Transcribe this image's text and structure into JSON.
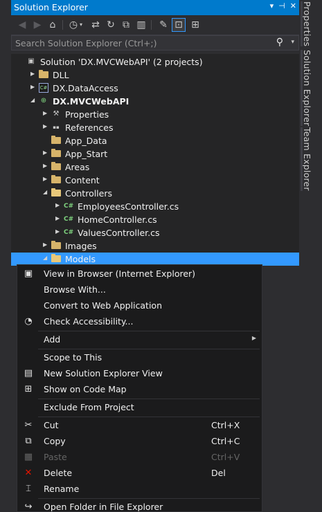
{
  "window": {
    "title": "Solution Explorer",
    "controls": [
      "▾",
      "⊣",
      "✕"
    ]
  },
  "right_tabs": [
    "Properties",
    "Solution Explorer",
    "Team Explorer"
  ],
  "search": {
    "placeholder": "Search Solution Explorer (Ctrl+;)"
  },
  "tree": [
    {
      "label": "Solution 'DX.MVCWebAPI' (2 projects)",
      "icon": "solution-icon",
      "indent": 0,
      "arrow": "",
      "bold": false,
      "selected": false
    },
    {
      "label": "DLL",
      "icon": "folder-icon",
      "indent": 1,
      "arrow": "▶",
      "bold": false,
      "selected": false
    },
    {
      "label": "DX.DataAccess",
      "icon": "csharp-project-icon",
      "indent": 1,
      "arrow": "▶",
      "bold": false,
      "selected": false
    },
    {
      "label": "DX.MVCWebAPI",
      "icon": "web-project-icon",
      "indent": 1,
      "arrow": "◢",
      "bold": true,
      "selected": false
    },
    {
      "label": "Properties",
      "icon": "wrench-icon",
      "indent": 2,
      "arrow": "▶",
      "bold": false,
      "selected": false
    },
    {
      "label": "References",
      "icon": "references-icon",
      "indent": 2,
      "arrow": "▶",
      "bold": false,
      "selected": false
    },
    {
      "label": "App_Data",
      "icon": "folder-icon",
      "indent": 2,
      "arrow": "",
      "bold": false,
      "selected": false
    },
    {
      "label": "App_Start",
      "icon": "folder-icon",
      "indent": 2,
      "arrow": "▶",
      "bold": false,
      "selected": false
    },
    {
      "label": "Areas",
      "icon": "folder-icon",
      "indent": 2,
      "arrow": "▶",
      "bold": false,
      "selected": false
    },
    {
      "label": "Content",
      "icon": "folder-icon",
      "indent": 2,
      "arrow": "▶",
      "bold": false,
      "selected": false
    },
    {
      "label": "Controllers",
      "icon": "folder-open-icon",
      "indent": 2,
      "arrow": "◢",
      "bold": false,
      "selected": false
    },
    {
      "label": "EmployeesController.cs",
      "icon": "csharp-file-icon",
      "indent": 3,
      "arrow": "▶",
      "bold": false,
      "selected": false
    },
    {
      "label": "HomeController.cs",
      "icon": "csharp-file-icon",
      "indent": 3,
      "arrow": "▶",
      "bold": false,
      "selected": false
    },
    {
      "label": "ValuesController.cs",
      "icon": "csharp-file-icon",
      "indent": 3,
      "arrow": "▶",
      "bold": false,
      "selected": false
    },
    {
      "label": "Images",
      "icon": "folder-icon",
      "indent": 2,
      "arrow": "▶",
      "bold": false,
      "selected": false
    },
    {
      "label": "Models",
      "icon": "folder-open-icon",
      "indent": 2,
      "arrow": "◢",
      "bold": false,
      "selected": true
    }
  ],
  "context_menu": {
    "items": [
      {
        "label": "View in Browser (Internet Explorer)",
        "icon": "browser-icon",
        "glyph": "▣",
        "shortcut": "",
        "submenu": false,
        "disabled": false,
        "sep_before": false
      },
      {
        "label": "Browse With...",
        "icon": "",
        "glyph": "",
        "shortcut": "",
        "submenu": false,
        "disabled": false,
        "sep_before": false
      },
      {
        "label": "Convert to Web Application",
        "icon": "",
        "glyph": "",
        "shortcut": "",
        "submenu": false,
        "disabled": false,
        "sep_before": false
      },
      {
        "label": "Check Accessibility...",
        "icon": "accessibility-icon",
        "glyph": "◔",
        "shortcut": "",
        "submenu": false,
        "disabled": false,
        "sep_before": false
      },
      {
        "label": "Add",
        "icon": "",
        "glyph": "",
        "shortcut": "",
        "submenu": true,
        "disabled": false,
        "sep_before": true
      },
      {
        "label": "Scope to This",
        "icon": "",
        "glyph": "",
        "shortcut": "",
        "submenu": false,
        "disabled": false,
        "sep_before": true
      },
      {
        "label": "New Solution Explorer View",
        "icon": "new-view-icon",
        "glyph": "▤",
        "shortcut": "",
        "submenu": false,
        "disabled": false,
        "sep_before": false
      },
      {
        "label": "Show on Code Map",
        "icon": "code-map-icon",
        "glyph": "⊞",
        "shortcut": "",
        "submenu": false,
        "disabled": false,
        "sep_before": false
      },
      {
        "label": "Exclude From Project",
        "icon": "",
        "glyph": "",
        "shortcut": "",
        "submenu": false,
        "disabled": false,
        "sep_before": true
      },
      {
        "label": "Cut",
        "icon": "cut-icon",
        "glyph": "✂",
        "shortcut": "Ctrl+X",
        "submenu": false,
        "disabled": false,
        "sep_before": true
      },
      {
        "label": "Copy",
        "icon": "copy-icon",
        "glyph": "⧉",
        "shortcut": "Ctrl+C",
        "submenu": false,
        "disabled": false,
        "sep_before": false
      },
      {
        "label": "Paste",
        "icon": "paste-icon",
        "glyph": "▦",
        "shortcut": "Ctrl+V",
        "submenu": false,
        "disabled": true,
        "sep_before": false
      },
      {
        "label": "Delete",
        "icon": "delete-icon",
        "glyph": "✕",
        "shortcut": "Del",
        "submenu": false,
        "disabled": false,
        "sep_before": false
      },
      {
        "label": "Rename",
        "icon": "rename-icon",
        "glyph": "⌶",
        "shortcut": "",
        "submenu": false,
        "disabled": false,
        "sep_before": false
      },
      {
        "label": "Open Folder in File Explorer",
        "icon": "open-folder-icon",
        "glyph": "↪",
        "shortcut": "",
        "submenu": false,
        "disabled": false,
        "sep_before": true
      }
    ]
  },
  "colors": {
    "accent": "#007acc",
    "selection": "#3399ff",
    "background": "#2d2d30",
    "tree_bg": "#252526",
    "menu_bg": "#1b1b1c",
    "delete_red": "#e51400"
  }
}
